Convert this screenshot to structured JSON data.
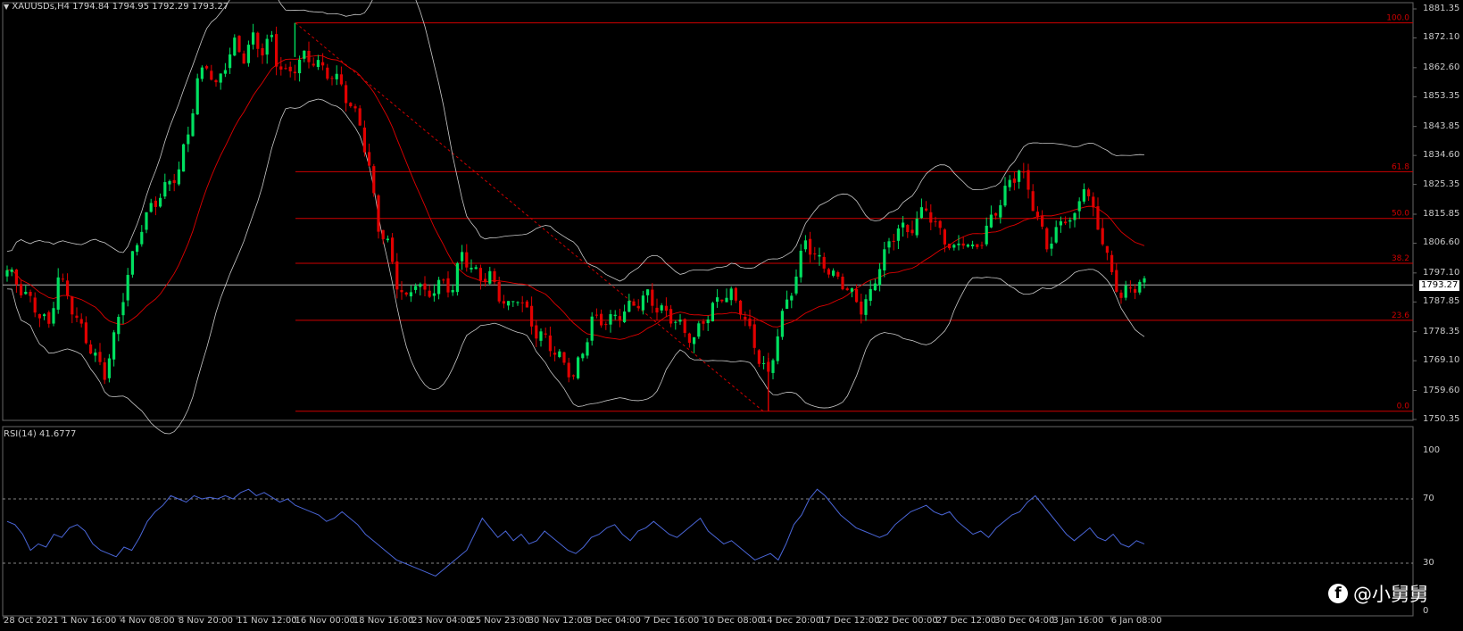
{
  "header": {
    "symbol": "XAUUSDs,H4",
    "open": "1794.84",
    "high": "1794.95",
    "low": "1792.29",
    "close": "1793.27"
  },
  "rsi": {
    "label": "RSI(14) 41.6777",
    "levels": [
      70,
      30
    ],
    "axis_labels": [
      "100",
      "70",
      "30",
      "0"
    ]
  },
  "current_price": "1793.27",
  "watermark": "@小舅舅",
  "colors": {
    "bull": "#00e060",
    "bear": "#e00000",
    "fib": "#d00000",
    "bands": "#c8c8c8",
    "rsi_line": "#4a66d8",
    "grid": "#666666"
  },
  "chart_data": [
    {
      "type": "candlestick",
      "title": "XAUUSDs,H4",
      "x_ticks": [
        "28 Oct 2021",
        "1 Nov 16:00",
        "4 Nov 08:00",
        "8 Nov 20:00",
        "11 Nov 12:00",
        "16 Nov 00:00",
        "18 Nov 16:00",
        "23 Nov 04:00",
        "25 Nov 23:00",
        "30 Nov 12:00",
        "3 Dec 04:00",
        "7 Dec 16:00",
        "10 Dec 08:00",
        "14 Dec 20:00",
        "17 Dec 12:00",
        "22 Dec 00:00",
        "27 Dec 12:00",
        "30 Dec 04:00",
        "3 Jan 16:00",
        "6 Jan 08:00"
      ],
      "y_ticks": [
        "1881.35",
        "1872.10",
        "1862.60",
        "1853.35",
        "1843.85",
        "1834.60",
        "1825.35",
        "1815.85",
        "1806.60",
        "1797.10",
        "1787.85",
        "1778.35",
        "1769.10",
        "1759.60",
        "1750.35"
      ],
      "ylim": [
        1750.35,
        1881.35
      ],
      "fibonacci": [
        {
          "label": "100.0",
          "price": 1876.9
        },
        {
          "label": "61.8",
          "price": 1829.4
        },
        {
          "label": "50.0",
          "price": 1814.5
        },
        {
          "label": "38.2",
          "price": 1800.2
        },
        {
          "label": "23.6",
          "price": 1782.0
        },
        {
          "label": "0.0",
          "price": 1753.0
        }
      ],
      "close_path_anchors": [
        [
          0,
          1798
        ],
        [
          3,
          1792
        ],
        [
          6,
          1786
        ],
        [
          9,
          1780
        ],
        [
          11,
          1796
        ],
        [
          13,
          1790
        ],
        [
          15,
          1782
        ],
        [
          17,
          1776
        ],
        [
          19,
          1770
        ],
        [
          21,
          1765
        ],
        [
          23,
          1776
        ],
        [
          25,
          1790
        ],
        [
          27,
          1802
        ],
        [
          29,
          1812
        ],
        [
          31,
          1818
        ],
        [
          33,
          1822
        ],
        [
          35,
          1826
        ],
        [
          37,
          1830
        ],
        [
          39,
          1842
        ],
        [
          41,
          1858
        ],
        [
          43,
          1864
        ],
        [
          45,
          1856
        ],
        [
          47,
          1864
        ],
        [
          49,
          1870
        ],
        [
          51,
          1866
        ],
        [
          53,
          1872
        ],
        [
          55,
          1868
        ],
        [
          57,
          1872
        ],
        [
          58,
          1865
        ],
        [
          60,
          1860
        ],
        [
          62,
          1863
        ],
        [
          64,
          1866
        ],
        [
          66,
          1865
        ],
        [
          68,
          1862
        ],
        [
          70,
          1860
        ],
        [
          72,
          1857
        ],
        [
          74,
          1850
        ],
        [
          76,
          1845
        ],
        [
          78,
          1830
        ],
        [
          80,
          1812
        ],
        [
          82,
          1806
        ],
        [
          84,
          1794
        ],
        [
          86,
          1788
        ],
        [
          88,
          1795
        ],
        [
          90,
          1790
        ],
        [
          92,
          1792
        ],
        [
          94,
          1794
        ],
        [
          96,
          1792
        ],
        [
          98,
          1804
        ],
        [
          100,
          1798
        ],
        [
          102,
          1796
        ],
        [
          104,
          1796
        ],
        [
          106,
          1790
        ],
        [
          108,
          1786
        ],
        [
          110,
          1790
        ],
        [
          112,
          1784
        ],
        [
          114,
          1778
        ],
        [
          116,
          1776
        ],
        [
          118,
          1772
        ],
        [
          120,
          1768
        ],
        [
          122,
          1764
        ],
        [
          124,
          1772
        ],
        [
          126,
          1782
        ],
        [
          128,
          1782
        ],
        [
          130,
          1782
        ],
        [
          132,
          1784
        ],
        [
          134,
          1786
        ],
        [
          136,
          1788
        ],
        [
          138,
          1790
        ],
        [
          140,
          1786
        ],
        [
          142,
          1784
        ],
        [
          144,
          1782
        ],
        [
          146,
          1778
        ],
        [
          148,
          1776
        ],
        [
          150,
          1782
        ],
        [
          152,
          1786
        ],
        [
          154,
          1790
        ],
        [
          156,
          1790
        ],
        [
          158,
          1786
        ],
        [
          160,
          1778
        ],
        [
          162,
          1770
        ],
        [
          164,
          1764
        ],
        [
          166,
          1778
        ],
        [
          168,
          1788
        ],
        [
          170,
          1796
        ],
        [
          172,
          1808
        ],
        [
          174,
          1802
        ],
        [
          176,
          1800
        ],
        [
          178,
          1796
        ],
        [
          180,
          1794
        ],
        [
          182,
          1790
        ],
        [
          184,
          1786
        ],
        [
          186,
          1790
        ],
        [
          188,
          1800
        ],
        [
          190,
          1806
        ],
        [
          192,
          1812
        ],
        [
          194,
          1810
        ],
        [
          196,
          1814
        ],
        [
          198,
          1818
        ],
        [
          200,
          1812
        ],
        [
          202,
          1808
        ],
        [
          204,
          1804
        ],
        [
          206,
          1808
        ],
        [
          208,
          1804
        ],
        [
          210,
          1808
        ],
        [
          212,
          1814
        ],
        [
          214,
          1820
        ],
        [
          216,
          1826
        ],
        [
          218,
          1830
        ],
        [
          220,
          1824
        ],
        [
          222,
          1814
        ],
        [
          224,
          1806
        ],
        [
          226,
          1810
        ],
        [
          228,
          1815
        ],
        [
          230,
          1814
        ],
        [
          232,
          1826
        ],
        [
          234,
          1816
        ],
        [
          236,
          1808
        ],
        [
          238,
          1796
        ],
        [
          240,
          1790
        ],
        [
          242,
          1792
        ],
        [
          244,
          1794
        ],
        [
          245,
          1793.27
        ]
      ]
    },
    {
      "type": "line",
      "title": "RSI(14) 41.6777",
      "ylim": [
        0,
        100
      ],
      "levels": [
        70,
        30
      ],
      "values": [
        56,
        54,
        48,
        38,
        42,
        40,
        48,
        46,
        52,
        54,
        50,
        42,
        38,
        36,
        34,
        40,
        38,
        46,
        56,
        62,
        66,
        72,
        70,
        68,
        72,
        70,
        71,
        70,
        72,
        70,
        74,
        76,
        72,
        74,
        71,
        68,
        70,
        66,
        64,
        62,
        60,
        56,
        58,
        62,
        58,
        54,
        48,
        44,
        40,
        36,
        32,
        30,
        28,
        26,
        24,
        22,
        26,
        30,
        34,
        38,
        48,
        58,
        52,
        46,
        50,
        44,
        48,
        42,
        44,
        50,
        46,
        42,
        38,
        36,
        40,
        46,
        48,
        52,
        54,
        48,
        44,
        50,
        52,
        56,
        52,
        48,
        46,
        50,
        54,
        58,
        50,
        46,
        42,
        44,
        40,
        36,
        32,
        34,
        36,
        32,
        42,
        54,
        60,
        70,
        76,
        72,
        66,
        60,
        56,
        52,
        50,
        48,
        46,
        48,
        54,
        58,
        62,
        64,
        66,
        62,
        60,
        62,
        56,
        52,
        48,
        50,
        46,
        52,
        56,
        60,
        62,
        68,
        72,
        66,
        60,
        54,
        48,
        44,
        48,
        52,
        46,
        44,
        48,
        42,
        40,
        44,
        42
      ]
    }
  ]
}
